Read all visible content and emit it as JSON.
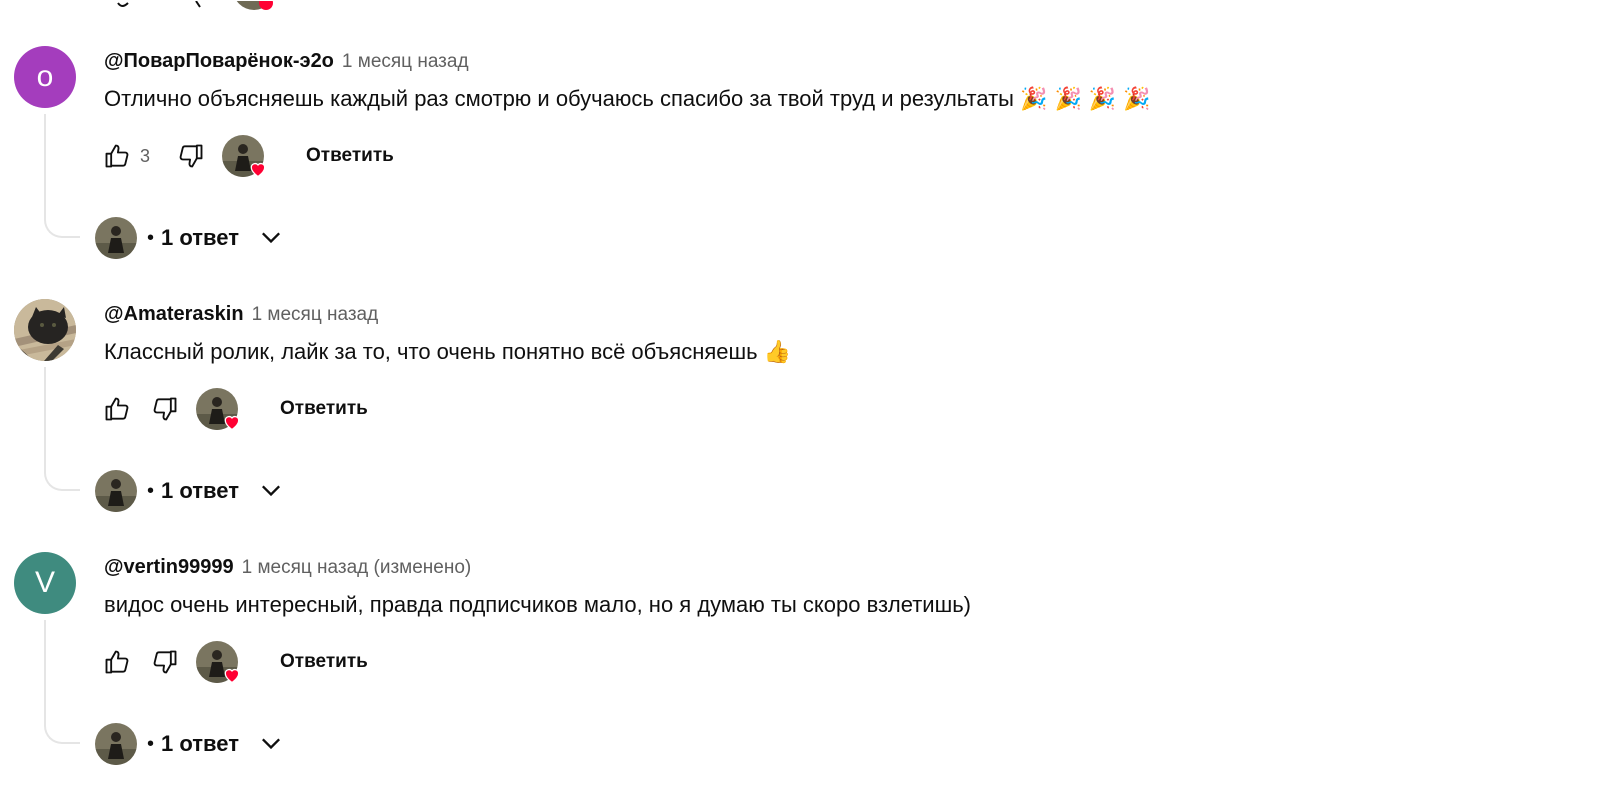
{
  "colors": {
    "avatar_purple": "#a43dbd",
    "avatar_teal": "#3f8b7f",
    "heart_red": "#ff0033",
    "meta_gray": "#606060"
  },
  "comments": [
    {
      "avatar_letter": "о",
      "author": "@ПоварПоварёнок-э2о",
      "time": "1 месяц назад",
      "text": "Отлично объясняешь каждый раз смотрю и обучаюсь спасибо за твой труд и результаты",
      "emoji": "🎉 🎉 🎉 🎉",
      "like_count": "3",
      "reply_label": "Ответить",
      "replies_label": "1 ответ"
    },
    {
      "avatar_letter": "",
      "author": "@Amateraskin",
      "time": "1 месяц назад",
      "text": "Классный ролик, лайк за то, что очень понятно всё объясняешь",
      "emoji": "👍",
      "like_count": "",
      "reply_label": "Ответить",
      "replies_label": "1 ответ"
    },
    {
      "avatar_letter": "V",
      "author": "@vertin99999",
      "time": "1 месяц назад (изменено)",
      "text": "видос очень интересный, правда подписчиков мало, но я думаю ты скоро взлетишь)",
      "emoji": "",
      "like_count": "",
      "reply_label": "Ответить",
      "replies_label": "1 ответ"
    }
  ]
}
